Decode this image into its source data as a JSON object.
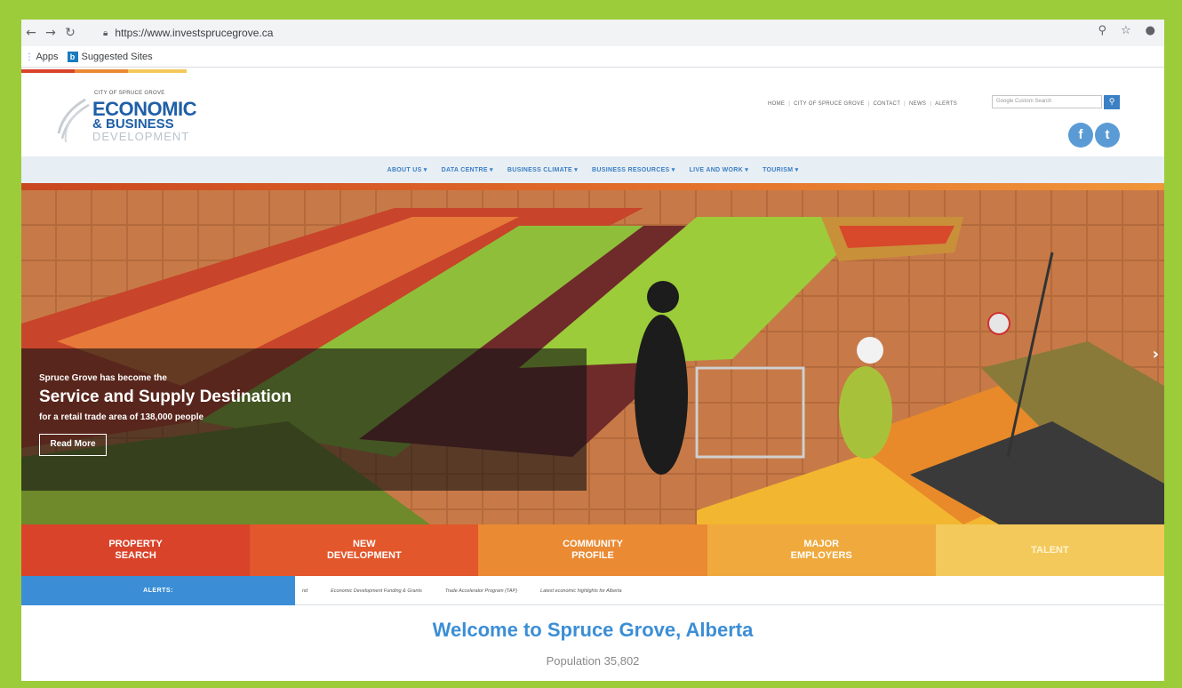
{
  "browser": {
    "url": "https://www.investsprucegrove.ca",
    "bookmarks": {
      "apps": "Apps",
      "suggested": "Suggested Sites"
    }
  },
  "logo": {
    "city": "CITY OF SPRUCE GROVE",
    "economic": "ECONOMIC",
    "business": "& BUSINESS",
    "development": "DEVELOPMENT"
  },
  "toplinks": [
    "HOME",
    "CITY OF SPRUCE GROVE",
    "CONTACT",
    "NEWS",
    "ALERTS"
  ],
  "search": {
    "placeholder": "Google Custom Search"
  },
  "social": {
    "facebook": "f",
    "twitter": "t"
  },
  "mainnav": [
    "ABOUT US",
    "DATA CENTRE",
    "BUSINESS CLIMATE",
    "BUSINESS RESOURCES",
    "LIVE AND WORK",
    "TOURISM"
  ],
  "hero": {
    "line1": "Spruce Grove has become the",
    "line2": "Service and Supply Destination",
    "line3": "for a retail trade area of 138,000 people",
    "read_more": "Read More"
  },
  "quicklinks": [
    {
      "label": "PROPERTY\nSEARCH",
      "color": "#d9432a"
    },
    {
      "label": "NEW\nDEVELOPMENT",
      "color": "#e2572b"
    },
    {
      "label": "COMMUNITY\nPROFILE",
      "color": "#ea8a33"
    },
    {
      "label": "MAJOR\nEMPLOYERS",
      "color": "#efa93d"
    },
    {
      "label": "TALENT",
      "color": "#f3c95b"
    }
  ],
  "alerts": {
    "label": "ALERTS:",
    "items": [
      "nd",
      "Economic Development Funding & Grants",
      "Trade Accelerator Program (TAP)",
      "Latest economic highlights for Alberta"
    ]
  },
  "welcome": {
    "title": "Welcome to Spruce Grove, Alberta",
    "population": "Population 35,802"
  }
}
